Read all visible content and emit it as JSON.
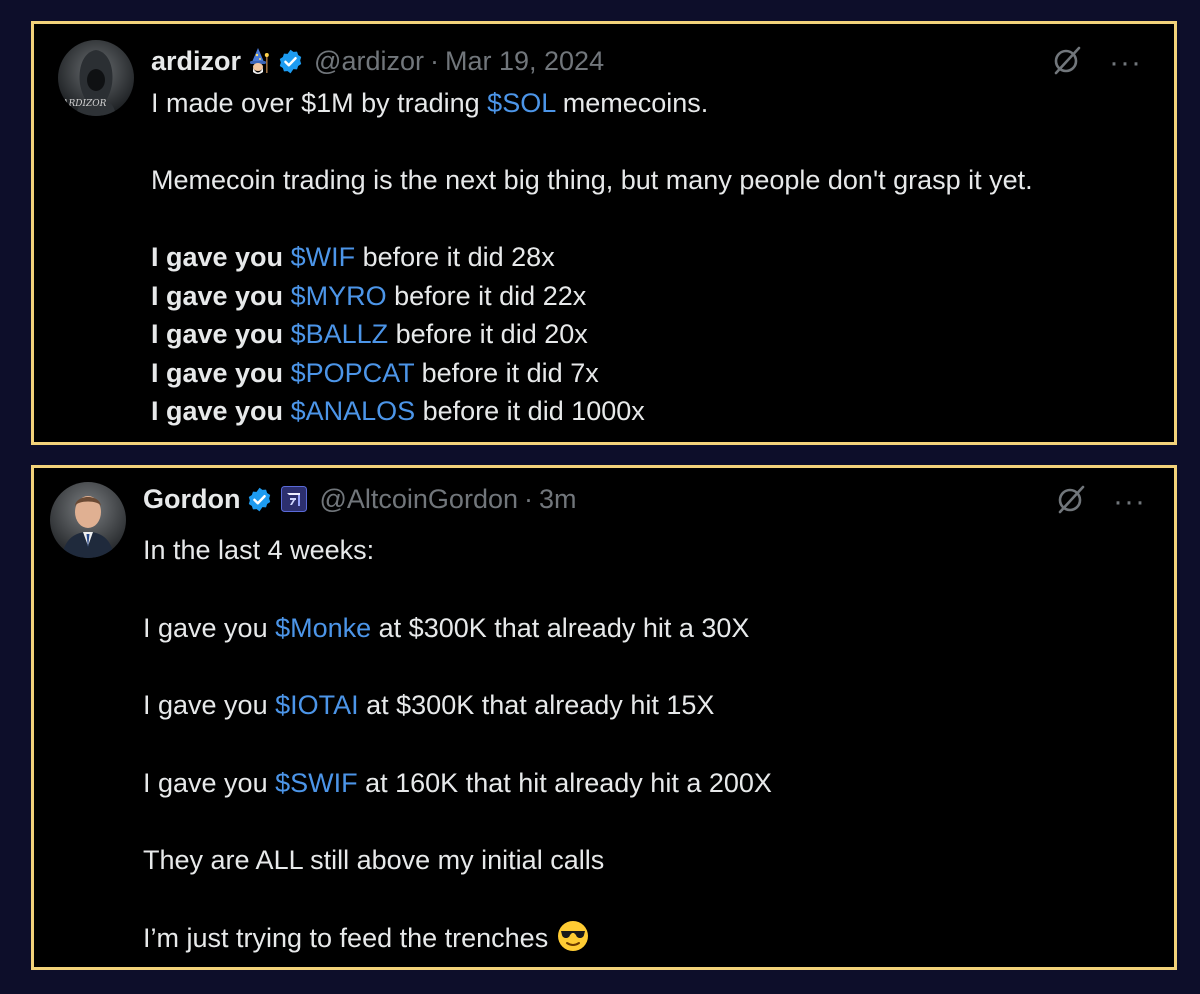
{
  "tweet1": {
    "name": "ardizor",
    "name_emoji": "🧙",
    "handle": "@ardizor",
    "separator": "·",
    "date": "Mar 19, 2024",
    "avatar_text": "ARDIZOR",
    "lines": [
      {
        "parts": [
          {
            "t": "I made over $1M by trading "
          },
          {
            "t": "$SOL",
            "tag": true
          },
          {
            "t": " memecoins."
          }
        ]
      },
      {
        "parts": []
      },
      {
        "parts": [
          {
            "t": "Memecoin trading is the next big thing, but many people don't grasp it yet."
          }
        ]
      },
      {
        "parts": []
      },
      {
        "parts": [
          {
            "t": "I gave you ",
            "bold": true
          },
          {
            "t": "$WIF",
            "tag": true
          },
          {
            "t": " before it did 28x"
          }
        ]
      },
      {
        "parts": [
          {
            "t": "I gave you ",
            "bold": true
          },
          {
            "t": "$MYRO",
            "tag": true
          },
          {
            "t": " before it did 22x"
          }
        ]
      },
      {
        "parts": [
          {
            "t": "I gave you ",
            "bold": true
          },
          {
            "t": "$BALLZ",
            "tag": true
          },
          {
            "t": " before it did 20x"
          }
        ]
      },
      {
        "parts": [
          {
            "t": "I gave you ",
            "bold": true
          },
          {
            "t": "$POPCAT",
            "tag": true
          },
          {
            "t": " before it did 7x"
          }
        ]
      },
      {
        "parts": [
          {
            "t": "I gave you ",
            "bold": true
          },
          {
            "t": "$ANALOS",
            "tag": true
          },
          {
            "t": " before it did 1000x"
          }
        ]
      }
    ]
  },
  "tweet2": {
    "name": "Gordon",
    "handle": "@AltcoinGordon",
    "separator": "·",
    "time": "3m",
    "lines": [
      {
        "parts": [
          {
            "t": "In the last 4 weeks:"
          }
        ]
      },
      {
        "parts": []
      },
      {
        "parts": [
          {
            "t": "I gave you "
          },
          {
            "t": "$Monke",
            "tag": true
          },
          {
            "t": " at $300K that already hit a 30X"
          }
        ]
      },
      {
        "parts": []
      },
      {
        "parts": [
          {
            "t": "I gave you "
          },
          {
            "t": "$IOTAI",
            "tag": true
          },
          {
            "t": " at $300K that already hit 15X"
          }
        ]
      },
      {
        "parts": []
      },
      {
        "parts": [
          {
            "t": "I gave you "
          },
          {
            "t": "$SWIF",
            "tag": true
          },
          {
            "t": " at 160K that hit already hit a 200X"
          }
        ]
      },
      {
        "parts": []
      },
      {
        "parts": [
          {
            "t": "They are ALL still above my initial calls"
          }
        ]
      },
      {
        "parts": []
      },
      {
        "parts": [
          {
            "t": "I’m just trying to feed the trenches "
          },
          {
            "emoji": "sunglasses"
          }
        ]
      }
    ]
  },
  "icons": {
    "verified": "verified-badge-icon",
    "grok": "grok-icon",
    "more": "more-icon",
    "more_glyph": "···"
  },
  "colors": {
    "background": "#0d0e2a",
    "card_border": "#f2d27a",
    "card_bg": "#000000",
    "text": "#e7e9ea",
    "muted": "#71767b",
    "cashtag": "#4c95e8",
    "verified": "#1d9bf0"
  }
}
